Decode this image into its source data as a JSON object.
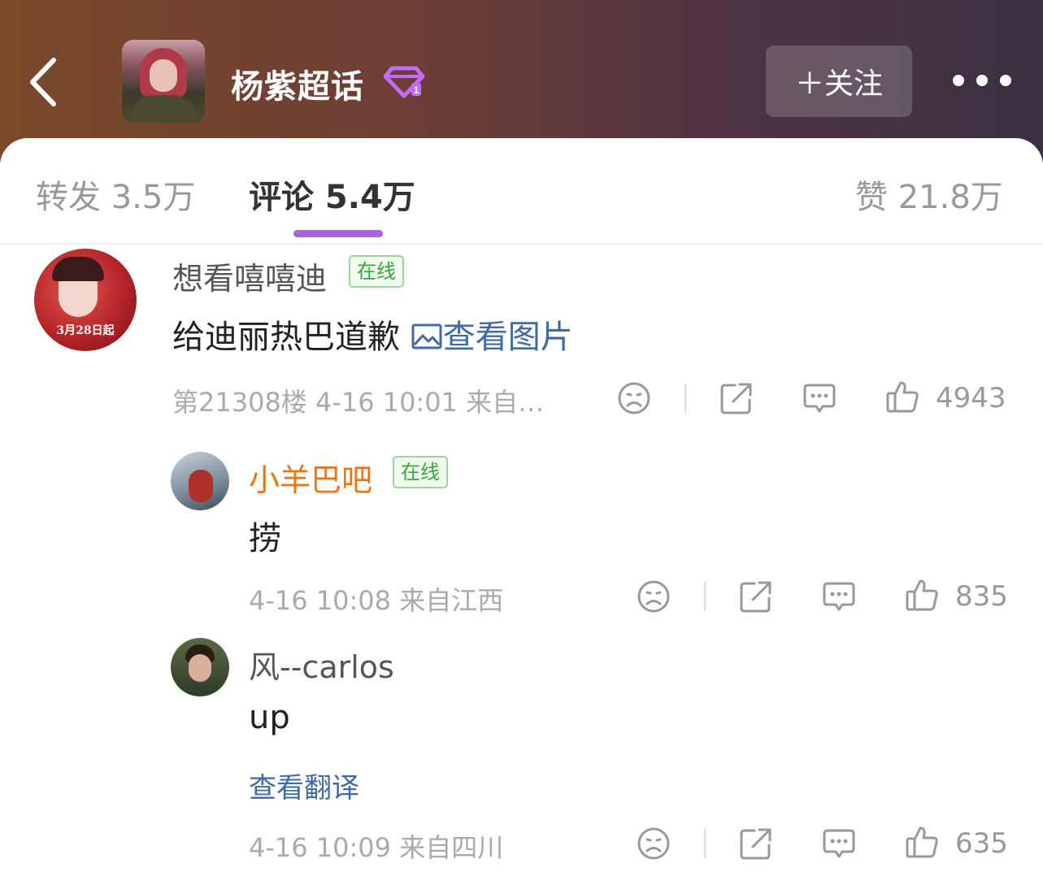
{
  "header": {
    "topic_title": "杨紫超话",
    "follow_label": "＋关注",
    "colors": {
      "gradient_start": "#7a4a2a",
      "gradient_end": "#3a3040"
    }
  },
  "tabs": [
    {
      "label": "转发 3.5万"
    },
    {
      "label": "评论 5.4万"
    },
    {
      "label": "赞 21.8万"
    }
  ],
  "comments": [
    {
      "user": "想看嘻嘻迪",
      "badge": "在线",
      "text": "给迪丽热巴道歉",
      "image_link": "查看图片",
      "meta": "第21308楼  4-16 10:01  来自…",
      "likes": "4943",
      "avatar_poster_text": "3月28日起"
    },
    {
      "user": "小羊巴吧",
      "badge": "在线",
      "text": "捞",
      "meta": "4-16 10:08  来自江西",
      "likes": "835"
    },
    {
      "user": "风--carlos",
      "text": "up",
      "translate": "查看翻译",
      "meta": "4-16 10:09  来自四川",
      "likes": "635"
    }
  ],
  "accent_colors": {
    "tab_indicator": "#a763e6",
    "link": "#3f6aa3",
    "online_badge": "#3aa53a",
    "vip_name": "#e8751a"
  }
}
